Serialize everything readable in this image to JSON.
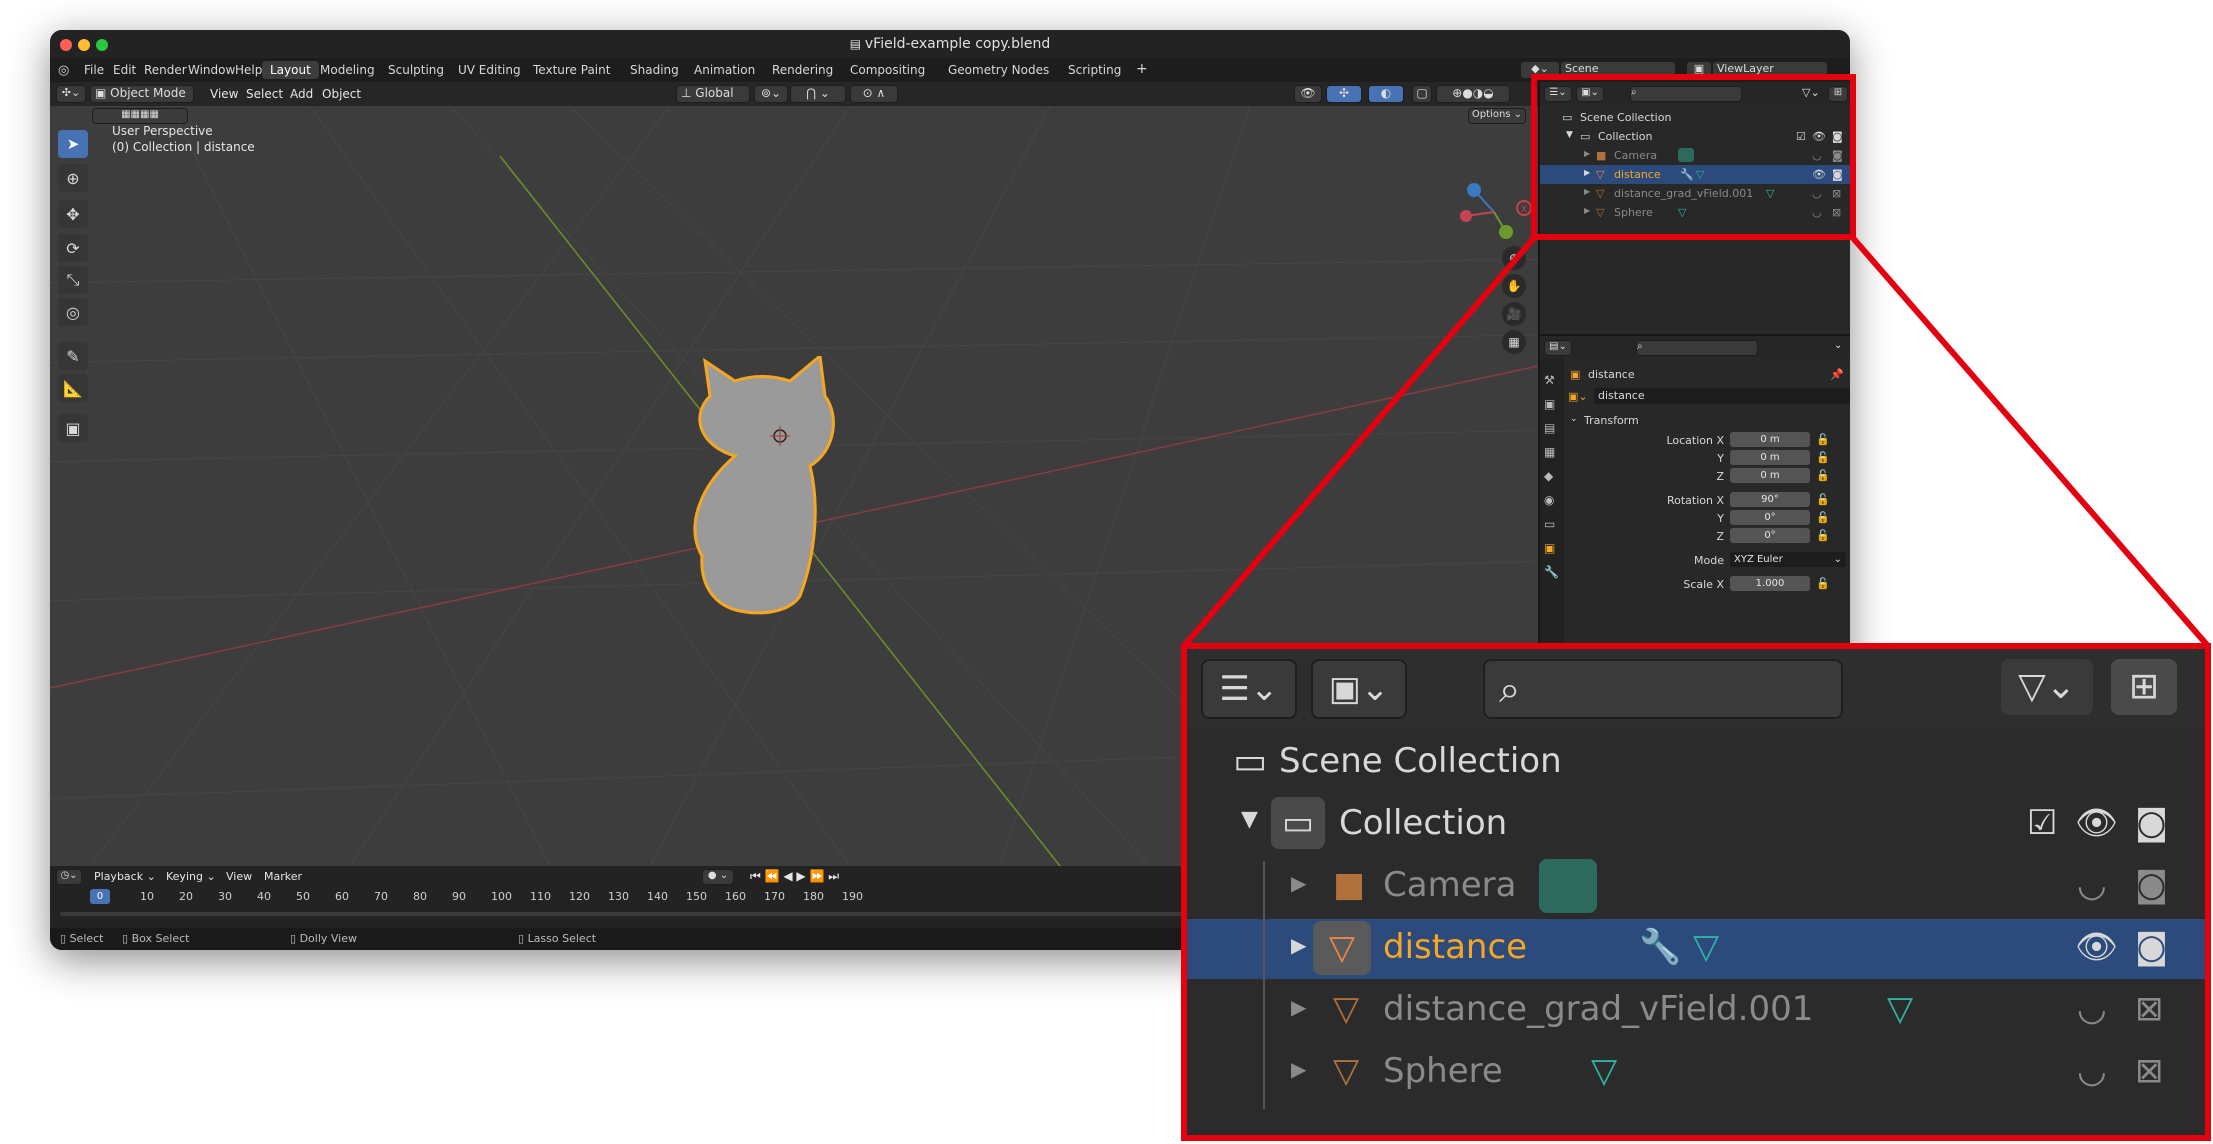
{
  "window": {
    "title": "vField-example copy.blend"
  },
  "menu": {
    "items": [
      "File",
      "Edit",
      "Render",
      "Window",
      "Help"
    ]
  },
  "workspaces": [
    "Layout",
    "Modeling",
    "Sculpting",
    "UV Editing",
    "Texture Paint",
    "Shading",
    "Animation",
    "Rendering",
    "Compositing",
    "Geometry Nodes",
    "Scripting"
  ],
  "topright": {
    "scene": "Scene",
    "viewlayer": "ViewLayer"
  },
  "viewport_header": {
    "mode": "Object Mode",
    "menus": [
      "View",
      "Select",
      "Add",
      "Object"
    ],
    "orientation": "Global",
    "options": "Options"
  },
  "viewport": {
    "perspective": "User Perspective",
    "context": "(0) Collection | distance"
  },
  "gizmo": {
    "x": "X",
    "y": "Y",
    "z": "Z"
  },
  "timeline": {
    "menus": [
      "Playback",
      "Keying",
      "View",
      "Marker"
    ],
    "current_frame": "0",
    "ticks": [
      "10",
      "20",
      "30",
      "40",
      "50",
      "60",
      "70",
      "80",
      "90",
      "100",
      "110",
      "120",
      "130",
      "140",
      "150",
      "160",
      "170",
      "180",
      "190"
    ]
  },
  "statusbar": {
    "select": "Select",
    "box_select": "Box Select",
    "dolly_view": "Dolly View",
    "lasso_select": "Lasso Select"
  },
  "outliner": {
    "scene_collection": "Scene Collection",
    "collection": "Collection",
    "rows": [
      {
        "name": "Camera"
      },
      {
        "name": "distance"
      },
      {
        "name": "distance_grad_vField.001"
      },
      {
        "name": "Sphere"
      }
    ]
  },
  "properties": {
    "object_name": "distance",
    "name_field": "distance",
    "section": "Transform",
    "location": {
      "label": "Location X",
      "x": "0 m",
      "y": "0 m",
      "z": "0 m"
    },
    "rotation": {
      "label": "Rotation X",
      "x": "90°",
      "y": "0°",
      "z": "0°"
    },
    "axis_y": "Y",
    "axis_z": "Z",
    "mode_label": "Mode",
    "mode_value": "XYZ Euler",
    "scale": {
      "label": "Scale X",
      "x": "1.000"
    }
  },
  "colors": {
    "accent": "#4772b3",
    "highlight": "#e5000f",
    "orange": "#f5a623",
    "selected_row": "#2c4a7c",
    "teal": "#2fb3a3"
  }
}
